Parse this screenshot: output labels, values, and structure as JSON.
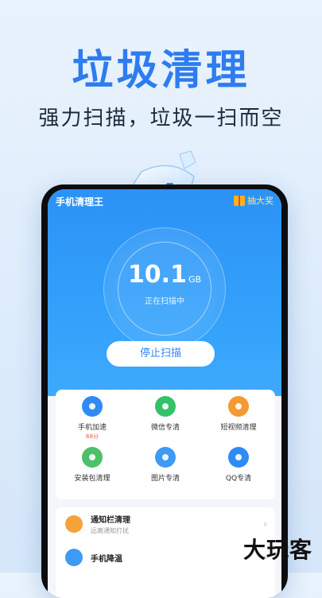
{
  "promo": {
    "headline": "垃圾清理",
    "subline": "强力扫描，垃圾一扫而空"
  },
  "app": {
    "title": "手机清理王",
    "prize_label": "抽大奖"
  },
  "scan": {
    "size_value": "10.1",
    "size_unit": "GB",
    "status": "正在扫描中",
    "stop_label": "停止扫描"
  },
  "tools": [
    {
      "label": "手机加速",
      "sub": "68分",
      "icon": "rocket-icon",
      "color": "#2f8bf3"
    },
    {
      "label": "微信专清",
      "sub": "",
      "icon": "wechat-icon",
      "color": "#34c16a"
    },
    {
      "label": "短视频清理",
      "sub": "",
      "icon": "video-icon",
      "color": "#f39a35"
    },
    {
      "label": "安装包清理",
      "sub": "",
      "icon": "android-icon",
      "color": "#4cc06a"
    },
    {
      "label": "图片专清",
      "sub": "",
      "icon": "image-icon",
      "color": "#3d9af5"
    },
    {
      "label": "QQ专清",
      "sub": "",
      "icon": "qq-icon",
      "color": "#2f8bf3"
    }
  ],
  "list": [
    {
      "title": "通知栏清理",
      "sub": "远离通知打扰",
      "icon": "bell-icon",
      "color": "#f5a23a"
    },
    {
      "title": "手机降温",
      "sub": "",
      "icon": "thermometer-icon",
      "color": "#3d9af5"
    }
  ],
  "watermark": "大玩客"
}
